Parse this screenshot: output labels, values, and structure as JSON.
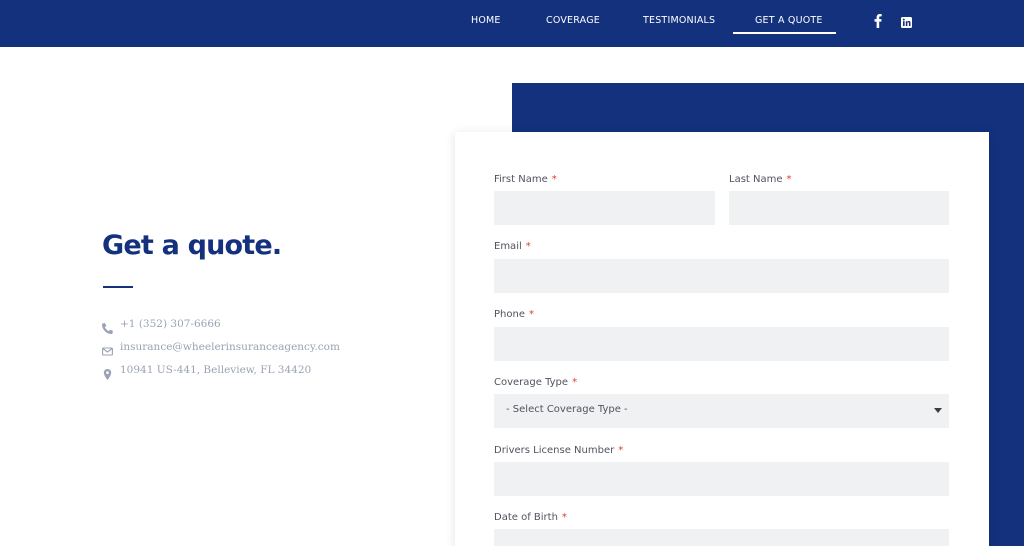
{
  "nav": {
    "items": [
      "HOME",
      "COVERAGE",
      "TESTIMONIALS",
      "GET A QUOTE"
    ],
    "active_index": 3,
    "social": [
      "facebook-icon",
      "linkedin-icon"
    ]
  },
  "hero": {
    "title": "Get a quote.",
    "contacts": [
      {
        "icon": "phone-icon",
        "text": "+1 (352) 307-6666"
      },
      {
        "icon": "envelope-icon",
        "text": "insurance@wheelerinsuranceagency.com"
      },
      {
        "icon": "map-marker-icon",
        "text": "10941 US-441, Belleview, FL 34420"
      }
    ]
  },
  "form": {
    "required_mark": "*",
    "fields": {
      "first_name": {
        "label": "First Name",
        "value": ""
      },
      "last_name": {
        "label": "Last Name",
        "value": ""
      },
      "email": {
        "label": "Email",
        "value": ""
      },
      "phone": {
        "label": "Phone",
        "value": ""
      },
      "coverage_type": {
        "label": "Coverage Type",
        "selected": "- Select Coverage Type -"
      },
      "drivers_license": {
        "label": "Drivers License Number",
        "value": ""
      },
      "dob": {
        "label": "Date of Birth",
        "value": ""
      }
    }
  },
  "colors": {
    "brand_navy": "#13317d",
    "input_bg": "#f0f1f3",
    "required": "#e0392e",
    "muted_text": "#9aa3b5"
  }
}
